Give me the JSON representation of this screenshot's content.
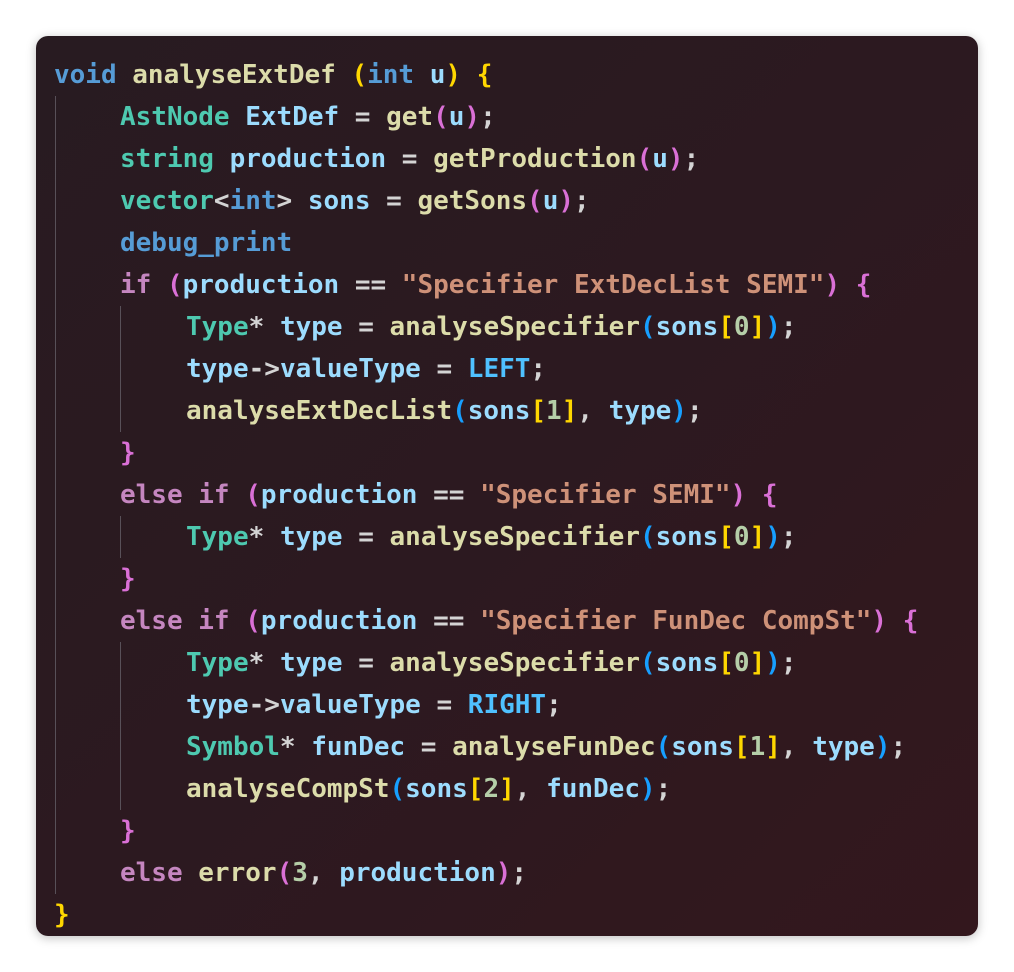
{
  "editor": {
    "language": "cpp",
    "lines": [
      {
        "indent": 0,
        "tokens": [
          {
            "t": "void",
            "c": "kw"
          },
          {
            "t": " ",
            "c": "op"
          },
          {
            "t": "analyseExtDef",
            "c": "fn"
          },
          {
            "t": " ",
            "c": "op"
          },
          {
            "t": "(",
            "c": "b1"
          },
          {
            "t": "int",
            "c": "kw"
          },
          {
            "t": " ",
            "c": "op"
          },
          {
            "t": "u",
            "c": "var"
          },
          {
            "t": ")",
            "c": "b1"
          },
          {
            "t": " ",
            "c": "op"
          },
          {
            "t": "{",
            "c": "b1"
          }
        ]
      },
      {
        "indent": 1,
        "tokens": [
          {
            "t": "AstNode",
            "c": "ty"
          },
          {
            "t": " ",
            "c": "op"
          },
          {
            "t": "ExtDef",
            "c": "var"
          },
          {
            "t": " = ",
            "c": "op"
          },
          {
            "t": "get",
            "c": "fn"
          },
          {
            "t": "(",
            "c": "b2"
          },
          {
            "t": "u",
            "c": "var"
          },
          {
            "t": ")",
            "c": "b2"
          },
          {
            "t": ";",
            "c": "op"
          }
        ]
      },
      {
        "indent": 1,
        "tokens": [
          {
            "t": "string",
            "c": "ty"
          },
          {
            "t": " ",
            "c": "op"
          },
          {
            "t": "production",
            "c": "var"
          },
          {
            "t": " = ",
            "c": "op"
          },
          {
            "t": "getProduction",
            "c": "fn"
          },
          {
            "t": "(",
            "c": "b2"
          },
          {
            "t": "u",
            "c": "var"
          },
          {
            "t": ")",
            "c": "b2"
          },
          {
            "t": ";",
            "c": "op"
          }
        ]
      },
      {
        "indent": 1,
        "tokens": [
          {
            "t": "vector",
            "c": "ty"
          },
          {
            "t": "<",
            "c": "op"
          },
          {
            "t": "int",
            "c": "kw"
          },
          {
            "t": ">",
            "c": "op"
          },
          {
            "t": " ",
            "c": "op"
          },
          {
            "t": "sons",
            "c": "var"
          },
          {
            "t": " = ",
            "c": "op"
          },
          {
            "t": "getSons",
            "c": "fn"
          },
          {
            "t": "(",
            "c": "b2"
          },
          {
            "t": "u",
            "c": "var"
          },
          {
            "t": ")",
            "c": "b2"
          },
          {
            "t": ";",
            "c": "op"
          }
        ]
      },
      {
        "indent": 1,
        "tokens": [
          {
            "t": "debug_print",
            "c": "kw"
          }
        ]
      },
      {
        "indent": 1,
        "tokens": [
          {
            "t": "if",
            "c": "ctl"
          },
          {
            "t": " ",
            "c": "op"
          },
          {
            "t": "(",
            "c": "b2"
          },
          {
            "t": "production",
            "c": "var"
          },
          {
            "t": " == ",
            "c": "op"
          },
          {
            "t": "\"Specifier ExtDecList SEMI\"",
            "c": "str"
          },
          {
            "t": ")",
            "c": "b2"
          },
          {
            "t": " ",
            "c": "op"
          },
          {
            "t": "{",
            "c": "b2"
          }
        ]
      },
      {
        "indent": 2,
        "tokens": [
          {
            "t": "Type",
            "c": "ty"
          },
          {
            "t": "*",
            "c": "op"
          },
          {
            "t": " ",
            "c": "op"
          },
          {
            "t": "type",
            "c": "var"
          },
          {
            "t": " = ",
            "c": "op"
          },
          {
            "t": "analyseSpecifier",
            "c": "fn"
          },
          {
            "t": "(",
            "c": "b3"
          },
          {
            "t": "sons",
            "c": "var"
          },
          {
            "t": "[",
            "c": "b1"
          },
          {
            "t": "0",
            "c": "num"
          },
          {
            "t": "]",
            "c": "b1"
          },
          {
            "t": ")",
            "c": "b3"
          },
          {
            "t": ";",
            "c": "op"
          }
        ]
      },
      {
        "indent": 2,
        "tokens": [
          {
            "t": "type",
            "c": "var"
          },
          {
            "t": "->",
            "c": "op"
          },
          {
            "t": "valueType",
            "c": "var"
          },
          {
            "t": " = ",
            "c": "op"
          },
          {
            "t": "LEFT",
            "c": "const"
          },
          {
            "t": ";",
            "c": "op"
          }
        ]
      },
      {
        "indent": 2,
        "tokens": [
          {
            "t": "analyseExtDecList",
            "c": "fn"
          },
          {
            "t": "(",
            "c": "b3"
          },
          {
            "t": "sons",
            "c": "var"
          },
          {
            "t": "[",
            "c": "b1"
          },
          {
            "t": "1",
            "c": "num"
          },
          {
            "t": "]",
            "c": "b1"
          },
          {
            "t": ", ",
            "c": "op"
          },
          {
            "t": "type",
            "c": "var"
          },
          {
            "t": ")",
            "c": "b3"
          },
          {
            "t": ";",
            "c": "op"
          }
        ]
      },
      {
        "indent": 1,
        "tokens": [
          {
            "t": "}",
            "c": "b2"
          }
        ]
      },
      {
        "indent": 1,
        "tokens": [
          {
            "t": "else",
            "c": "ctl"
          },
          {
            "t": " ",
            "c": "op"
          },
          {
            "t": "if",
            "c": "ctl"
          },
          {
            "t": " ",
            "c": "op"
          },
          {
            "t": "(",
            "c": "b2"
          },
          {
            "t": "production",
            "c": "var"
          },
          {
            "t": " == ",
            "c": "op"
          },
          {
            "t": "\"Specifier SEMI\"",
            "c": "str"
          },
          {
            "t": ")",
            "c": "b2"
          },
          {
            "t": " ",
            "c": "op"
          },
          {
            "t": "{",
            "c": "b2"
          }
        ]
      },
      {
        "indent": 2,
        "tokens": [
          {
            "t": "Type",
            "c": "ty"
          },
          {
            "t": "*",
            "c": "op"
          },
          {
            "t": " ",
            "c": "op"
          },
          {
            "t": "type",
            "c": "var"
          },
          {
            "t": " = ",
            "c": "op"
          },
          {
            "t": "analyseSpecifier",
            "c": "fn"
          },
          {
            "t": "(",
            "c": "b3"
          },
          {
            "t": "sons",
            "c": "var"
          },
          {
            "t": "[",
            "c": "b1"
          },
          {
            "t": "0",
            "c": "num"
          },
          {
            "t": "]",
            "c": "b1"
          },
          {
            "t": ")",
            "c": "b3"
          },
          {
            "t": ";",
            "c": "op"
          }
        ]
      },
      {
        "indent": 1,
        "tokens": [
          {
            "t": "}",
            "c": "b2"
          }
        ]
      },
      {
        "indent": 1,
        "tokens": [
          {
            "t": "else",
            "c": "ctl"
          },
          {
            "t": " ",
            "c": "op"
          },
          {
            "t": "if",
            "c": "ctl"
          },
          {
            "t": " ",
            "c": "op"
          },
          {
            "t": "(",
            "c": "b2"
          },
          {
            "t": "production",
            "c": "var"
          },
          {
            "t": " == ",
            "c": "op"
          },
          {
            "t": "\"Specifier FunDec CompSt\"",
            "c": "str"
          },
          {
            "t": ")",
            "c": "b2"
          },
          {
            "t": " ",
            "c": "op"
          },
          {
            "t": "{",
            "c": "b2"
          }
        ]
      },
      {
        "indent": 2,
        "tokens": [
          {
            "t": "Type",
            "c": "ty"
          },
          {
            "t": "*",
            "c": "op"
          },
          {
            "t": " ",
            "c": "op"
          },
          {
            "t": "type",
            "c": "var"
          },
          {
            "t": " = ",
            "c": "op"
          },
          {
            "t": "analyseSpecifier",
            "c": "fn"
          },
          {
            "t": "(",
            "c": "b3"
          },
          {
            "t": "sons",
            "c": "var"
          },
          {
            "t": "[",
            "c": "b1"
          },
          {
            "t": "0",
            "c": "num"
          },
          {
            "t": "]",
            "c": "b1"
          },
          {
            "t": ")",
            "c": "b3"
          },
          {
            "t": ";",
            "c": "op"
          }
        ]
      },
      {
        "indent": 2,
        "tokens": [
          {
            "t": "type",
            "c": "var"
          },
          {
            "t": "->",
            "c": "op"
          },
          {
            "t": "valueType",
            "c": "var"
          },
          {
            "t": " = ",
            "c": "op"
          },
          {
            "t": "RIGHT",
            "c": "const"
          },
          {
            "t": ";",
            "c": "op"
          }
        ]
      },
      {
        "indent": 2,
        "tokens": [
          {
            "t": "Symbol",
            "c": "ty"
          },
          {
            "t": "*",
            "c": "op"
          },
          {
            "t": " ",
            "c": "op"
          },
          {
            "t": "funDec",
            "c": "var"
          },
          {
            "t": " = ",
            "c": "op"
          },
          {
            "t": "analyseFunDec",
            "c": "fn"
          },
          {
            "t": "(",
            "c": "b3"
          },
          {
            "t": "sons",
            "c": "var"
          },
          {
            "t": "[",
            "c": "b1"
          },
          {
            "t": "1",
            "c": "num"
          },
          {
            "t": "]",
            "c": "b1"
          },
          {
            "t": ", ",
            "c": "op"
          },
          {
            "t": "type",
            "c": "var"
          },
          {
            "t": ")",
            "c": "b3"
          },
          {
            "t": ";",
            "c": "op"
          }
        ]
      },
      {
        "indent": 2,
        "tokens": [
          {
            "t": "analyseCompSt",
            "c": "fn"
          },
          {
            "t": "(",
            "c": "b3"
          },
          {
            "t": "sons",
            "c": "var"
          },
          {
            "t": "[",
            "c": "b1"
          },
          {
            "t": "2",
            "c": "num"
          },
          {
            "t": "]",
            "c": "b1"
          },
          {
            "t": ", ",
            "c": "op"
          },
          {
            "t": "funDec",
            "c": "var"
          },
          {
            "t": ")",
            "c": "b3"
          },
          {
            "t": ";",
            "c": "op"
          }
        ]
      },
      {
        "indent": 1,
        "tokens": [
          {
            "t": "}",
            "c": "b2"
          }
        ]
      },
      {
        "indent": 1,
        "tokens": [
          {
            "t": "else",
            "c": "ctl"
          },
          {
            "t": " ",
            "c": "op"
          },
          {
            "t": "error",
            "c": "fn"
          },
          {
            "t": "(",
            "c": "b2"
          },
          {
            "t": "3",
            "c": "num"
          },
          {
            "t": ", ",
            "c": "op"
          },
          {
            "t": "production",
            "c": "var"
          },
          {
            "t": ")",
            "c": "b2"
          },
          {
            "t": ";",
            "c": "op"
          }
        ]
      },
      {
        "indent": 0,
        "tokens": [
          {
            "t": "}",
            "c": "b1"
          }
        ]
      }
    ]
  },
  "colors": {
    "background": "#2c1920",
    "keyword": "#569cd6",
    "control": "#c586c0",
    "type": "#4ec9b0",
    "function": "#dcdcaa",
    "variable": "#9cdcfe",
    "string": "#ce9178",
    "number": "#b5cea8",
    "constant": "#4fc1ff",
    "bracket_1": "#ffd700",
    "bracket_2": "#da70d6",
    "bracket_3": "#179fff"
  }
}
